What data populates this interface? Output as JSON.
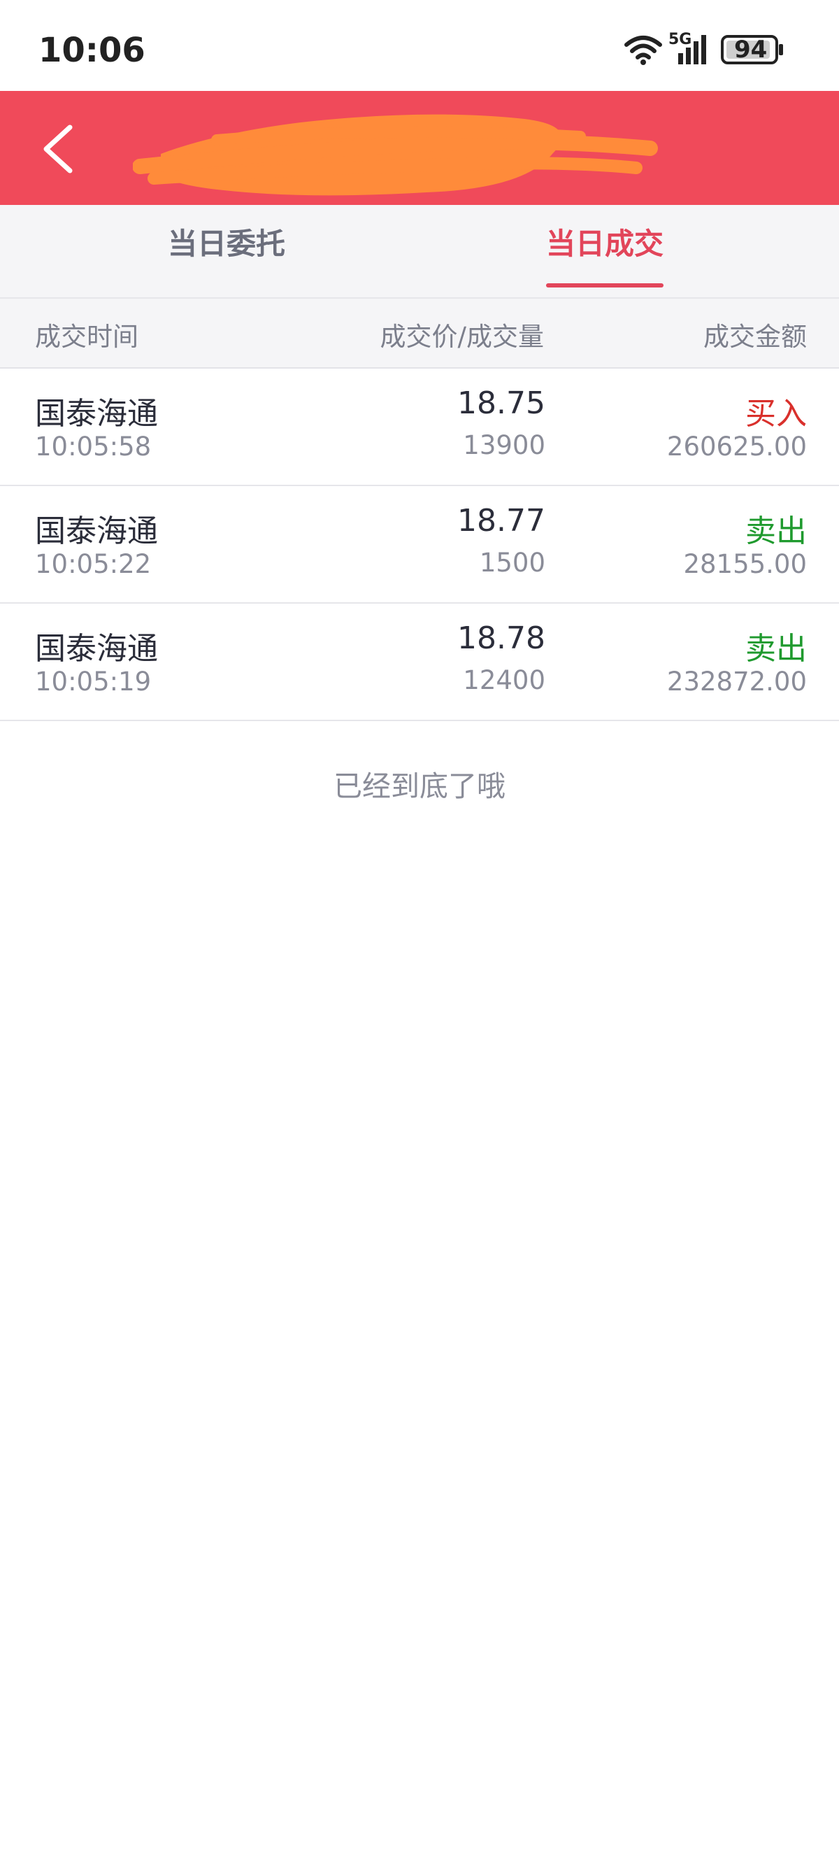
{
  "status_bar": {
    "time": "10:06",
    "network": "5G",
    "battery": "94"
  },
  "header": {
    "back_icon": "chevron-left-icon",
    "color": "#f04a5a"
  },
  "tabs": [
    {
      "label": "当日委托",
      "active": false
    },
    {
      "label": "当日成交",
      "active": true
    }
  ],
  "columns": {
    "time": "成交时间",
    "price_volume": "成交价/成交量",
    "amount": "成交金额"
  },
  "trades": [
    {
      "name": "国泰海通",
      "time": "10:05:58",
      "price": "18.75",
      "volume": "13900",
      "direction": "买入",
      "direction_color": "#d9302c",
      "amount": "260625.00"
    },
    {
      "name": "国泰海通",
      "time": "10:05:22",
      "price": "18.77",
      "volume": "1500",
      "direction": "卖出",
      "direction_color": "#1f9a2e",
      "amount": "28155.00"
    },
    {
      "name": "国泰海通",
      "time": "10:05:19",
      "price": "18.78",
      "volume": "12400",
      "direction": "卖出",
      "direction_color": "#1f9a2e",
      "amount": "232872.00"
    }
  ],
  "footer": {
    "end_text": "已经到底了哦"
  }
}
